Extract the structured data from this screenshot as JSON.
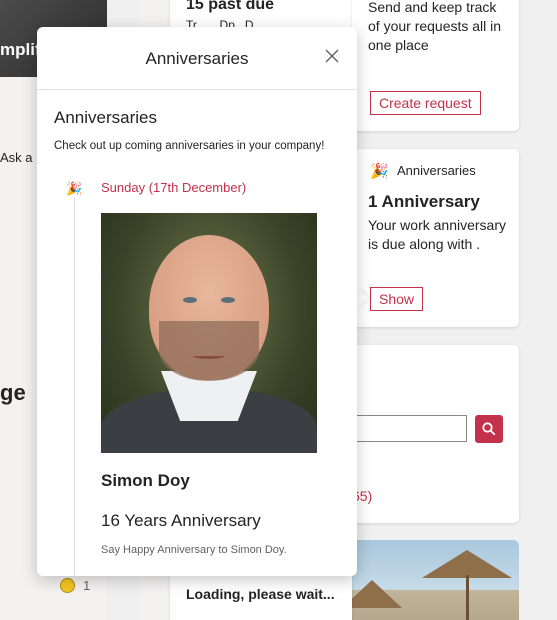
{
  "background": {
    "left": {
      "banner_text": "mplify",
      "ask_text": "Ask a",
      "heading_text": "ge",
      "reaction_count": "1"
    },
    "tasks_card": {
      "title": "15 past due",
      "subtitle": "Tr... ...Dp.. D... ..."
    },
    "requests_card": {
      "description": "Send and keep track of your requests all in one place",
      "button": "Create request"
    },
    "anniversary_card": {
      "header": "Anniversaries",
      "count_title": "1 Anniversary",
      "text": "Your work anniversary is due along with .",
      "button": "Show"
    },
    "search_card": {
      "link_text": "65)"
    },
    "news_card": {
      "text": "Loading, please wait..."
    }
  },
  "popup": {
    "title": "Anniversaries",
    "close_icon": "close-icon",
    "section_title": "Anniversaries",
    "section_subtitle": "Check out up coming anniversaries in your company!",
    "entries": [
      {
        "date": "Sunday (17th December)",
        "name": "Simon Doy",
        "years": "16 Years Anniversary",
        "message": "Say Happy Anniversary to Simon Doy."
      }
    ]
  },
  "colors": {
    "accent": "#c4314b",
    "text": "#242424",
    "muted": "#616161"
  }
}
